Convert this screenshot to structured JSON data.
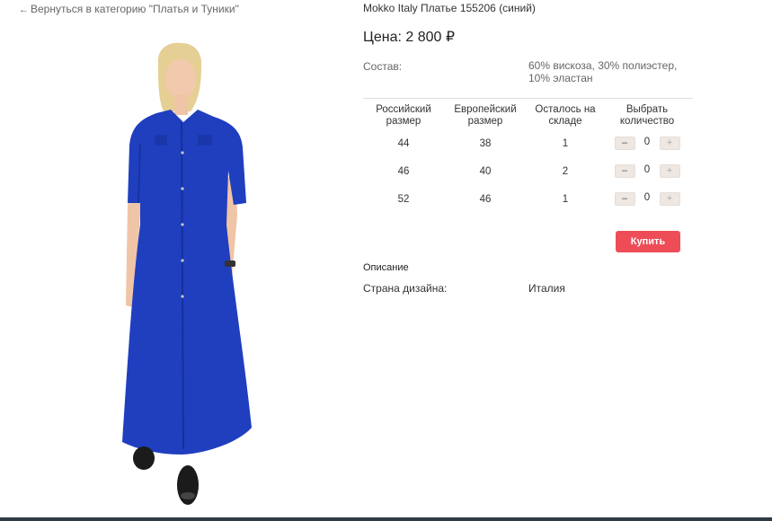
{
  "nav": {
    "back_arrow_icon": "arrow-left-icon",
    "back_label": "Вернуться в категорию \"Платья и Туники\""
  },
  "product": {
    "title": "Mokko Italy Платье 155206 (синий)",
    "price": "Цена: 2 800 ₽",
    "composition_label": "Состав:",
    "composition_value": "60% вискоза, 30% полиэстер, 10% эластан",
    "dress_color": "#1f3fbf"
  },
  "table": {
    "headers": [
      "Российский размер",
      "Европейский размер",
      "Осталось на складе",
      "Выбрать количество"
    ],
    "rows": [
      {
        "ru": "44",
        "eu": "38",
        "stock": "1",
        "qty": "0"
      },
      {
        "ru": "46",
        "eu": "40",
        "stock": "2",
        "qty": "0"
      },
      {
        "ru": "52",
        "eu": "46",
        "stock": "1",
        "qty": "0"
      }
    ],
    "minus_label": "–",
    "plus_label": "+"
  },
  "buy": {
    "label": "Купить",
    "color": "#ee4d58"
  },
  "description": {
    "heading": "Описание",
    "country_label": "Страна дизайна:",
    "country_value": "Италия"
  }
}
